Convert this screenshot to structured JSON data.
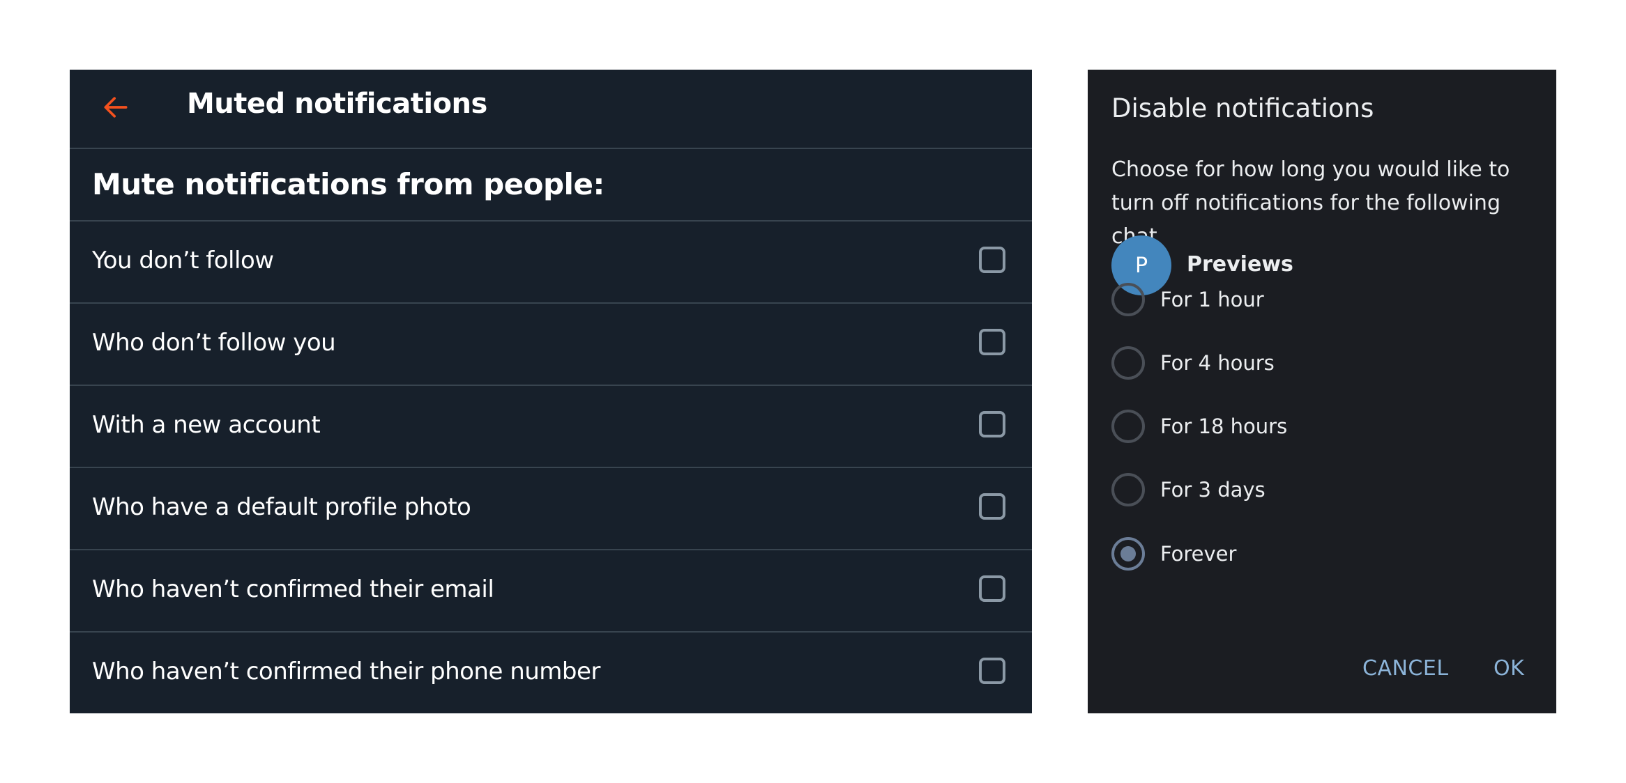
{
  "left_panel": {
    "title": "Muted notifications",
    "section_heading": "Mute notifications from people:",
    "accent_color": "#f4511e",
    "options": [
      {
        "label": "You don’t follow",
        "checked": false
      },
      {
        "label": "Who don’t follow you",
        "checked": false
      },
      {
        "label": "With a new account",
        "checked": false
      },
      {
        "label": "Who have a default profile photo",
        "checked": false
      },
      {
        "label": "Who haven’t confirmed their email",
        "checked": false
      },
      {
        "label": "Who haven’t confirmed their phone number",
        "checked": false
      }
    ]
  },
  "dialog": {
    "title": "Disable notifications",
    "description": "Choose for how long you would like to turn off notifications for the following chat",
    "chat": {
      "avatar_letter": "P",
      "name": "Previews",
      "avatar_color": "#4386bd"
    },
    "options": [
      {
        "label": "For 1 hour",
        "selected": false
      },
      {
        "label": "For 4 hours",
        "selected": false
      },
      {
        "label": "For 18 hours",
        "selected": false
      },
      {
        "label": "For 3 days",
        "selected": false
      },
      {
        "label": "Forever",
        "selected": true
      }
    ],
    "cancel_label": "CANCEL",
    "ok_label": "OK"
  }
}
